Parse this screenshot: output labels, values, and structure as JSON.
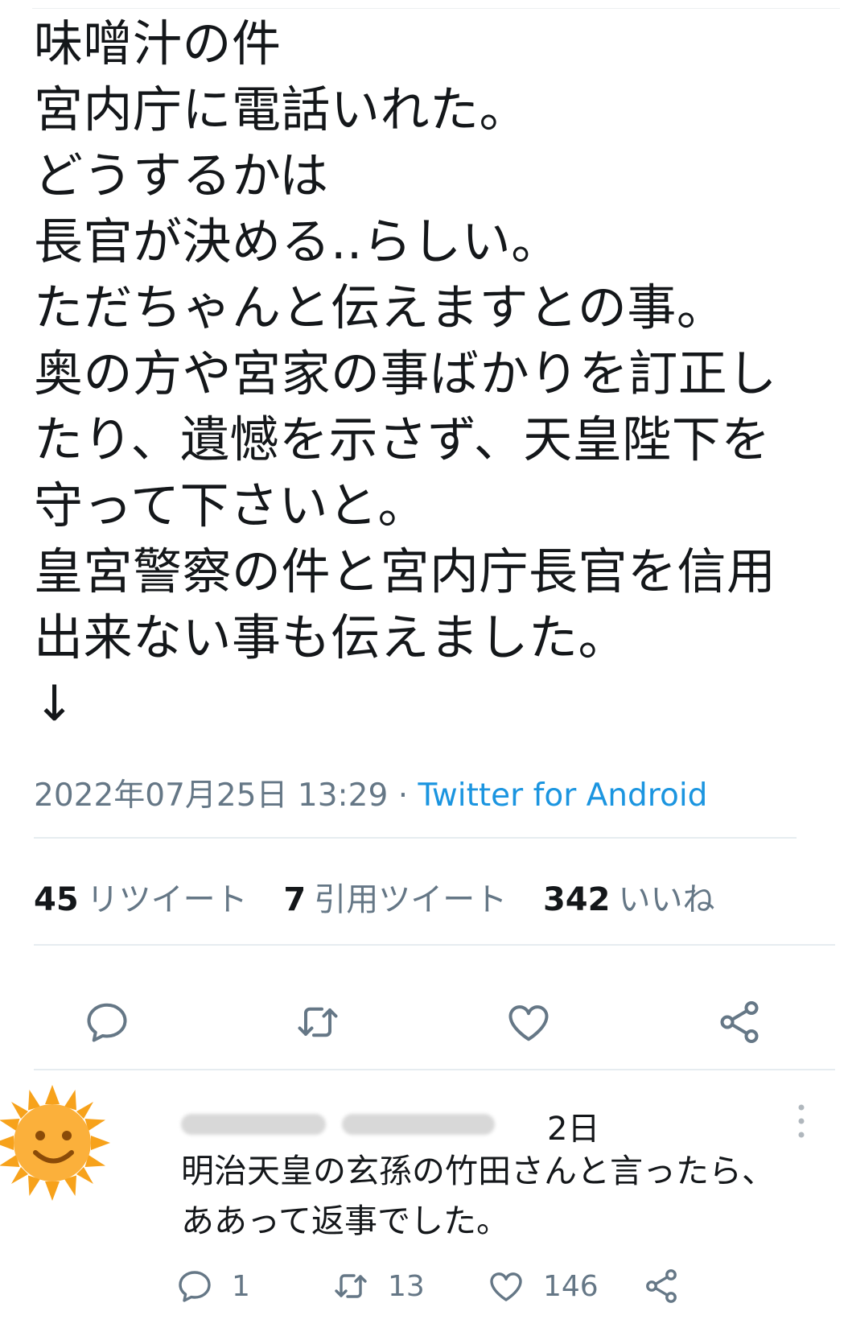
{
  "tweet": {
    "lines": [
      "味噌汁の件",
      "宮内庁に電話いれた。",
      "どうするかは",
      "長官が決める..らしい。",
      "ただちゃんと伝えますとの事。",
      "奥の方や宮家の事ばかりを訂正し",
      "たり、遺憾を示さず、天皇陛下を",
      "守って下さいと。",
      "皇宮警察の件と宮内庁長官を信用",
      "出来ない事も伝えました。",
      "↓"
    ],
    "timestamp": "2022年07月25日 13:29",
    "separator": " · ",
    "source": "Twitter for Android"
  },
  "stats": {
    "retweets_count": "45",
    "retweets_label": "リツイート",
    "quotes_count": "7",
    "quotes_label": "引用ツイート",
    "likes_count": "342",
    "likes_label": "いいね"
  },
  "actions": [
    "reply-icon",
    "retweet-icon",
    "like-icon",
    "share-icon"
  ],
  "reply": {
    "avatar_icon": "sun-face-icon",
    "date_suffix": "2日",
    "lines": [
      "明治天皇の玄孫の竹田さんと言ったら、",
      "ああって返事でした。"
    ],
    "reply_count": "1",
    "retweet_count": "13",
    "like_count": "146"
  },
  "colors": {
    "text": "#14171a",
    "muted": "#657786",
    "link": "#1b95e0",
    "divider": "#e6ecf0",
    "sun": "#f7a21b"
  }
}
